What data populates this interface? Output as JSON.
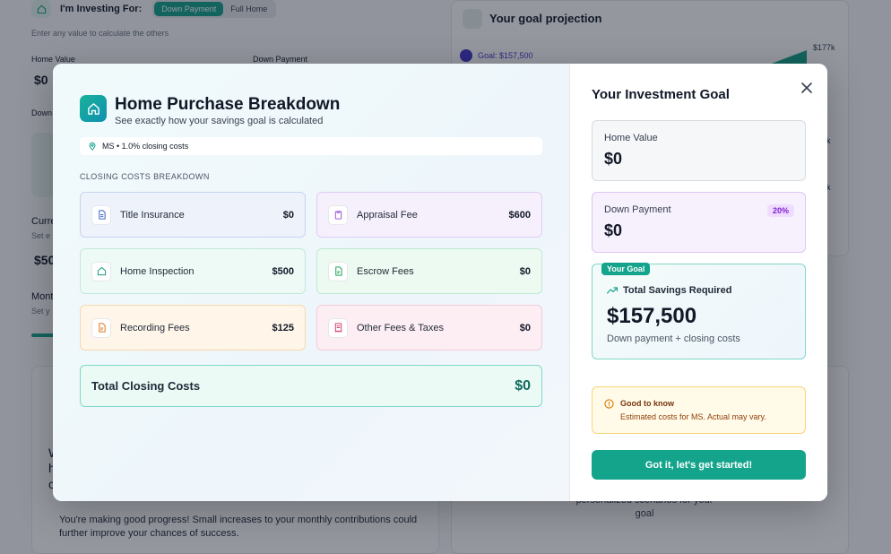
{
  "background": {
    "investing_label": "I'm Investing For:",
    "mode_tabs": [
      "Down Payment",
      "Full Home"
    ],
    "hint": "Enter any value to calculate the others",
    "home_value_label": "Home Value",
    "home_value": "$0",
    "down_payment_label": "Down Payment",
    "down_label_partial": "Down",
    "current_label_partial": "Curre",
    "current_sub_partial": "Set e",
    "current_value_partial": "$50",
    "monthly_label_partial": "Mont",
    "monthly_sub_partial": "Set y",
    "projection_title": "Your goal projection",
    "goal_marker": "Goal: $157,500",
    "axis_top": "$177k",
    "axis_k1": "k",
    "axis_k2": "k",
    "left_partial_1": "W",
    "left_partial_2": "h",
    "left_partial_3": "c",
    "progress_text": "You're making good progress! Small increases to your monthly contributions could further improve your chances of success.",
    "scenario_text": "personalized scenarios for your goal"
  },
  "modal": {
    "title": "Home Purchase Breakdown",
    "subtitle": "See exactly how your savings goal is calculated",
    "location": "MS • 1.0% closing costs",
    "section_label": "CLOSING COSTS BREAKDOWN",
    "costs": [
      {
        "name": "Title Insurance",
        "amount": "$0",
        "icon": "document-icon",
        "bg": "#eef2fb",
        "border": "#c7d4f2",
        "accent": "#3b63c9"
      },
      {
        "name": "Appraisal Fee",
        "amount": "$600",
        "icon": "clipboard-icon",
        "bg": "#f6effc",
        "border": "#e0cdf5",
        "accent": "#9d5ad8"
      },
      {
        "name": "Home Inspection",
        "amount": "$500",
        "icon": "home-icon",
        "bg": "#eefaf6",
        "border": "#bfe8dc",
        "accent": "#1a9c7f"
      },
      {
        "name": "Escrow Fees",
        "amount": "$0",
        "icon": "file-text-icon",
        "bg": "#ecfaf1",
        "border": "#bfe9cf",
        "accent": "#22a35a"
      },
      {
        "name": "Recording Fees",
        "amount": "$125",
        "icon": "file-text-icon",
        "bg": "#fff5e9",
        "border": "#f6d9b0",
        "accent": "#e1781c"
      },
      {
        "name": "Other Fees & Taxes",
        "amount": "$0",
        "icon": "receipt-icon",
        "bg": "#fdeef3",
        "border": "#f5cad8",
        "accent": "#d8456f"
      }
    ],
    "total_label": "Total Closing Costs",
    "total_amount": "$0",
    "goal_heading": "Your Investment Goal",
    "home_value_label": "Home Value",
    "home_value": "$0",
    "down_payment_label": "Down Payment",
    "down_payment": "$0",
    "down_payment_pct": "20%",
    "goal_badge": "Your Goal",
    "savings_label": "Total Savings Required",
    "savings_amount": "$157,500",
    "savings_note": "Down payment + closing costs",
    "notice_title": "Good to know",
    "notice_body": "Estimated costs for MS. Actual may vary.",
    "cta_label": "Got it, let's get started!"
  }
}
